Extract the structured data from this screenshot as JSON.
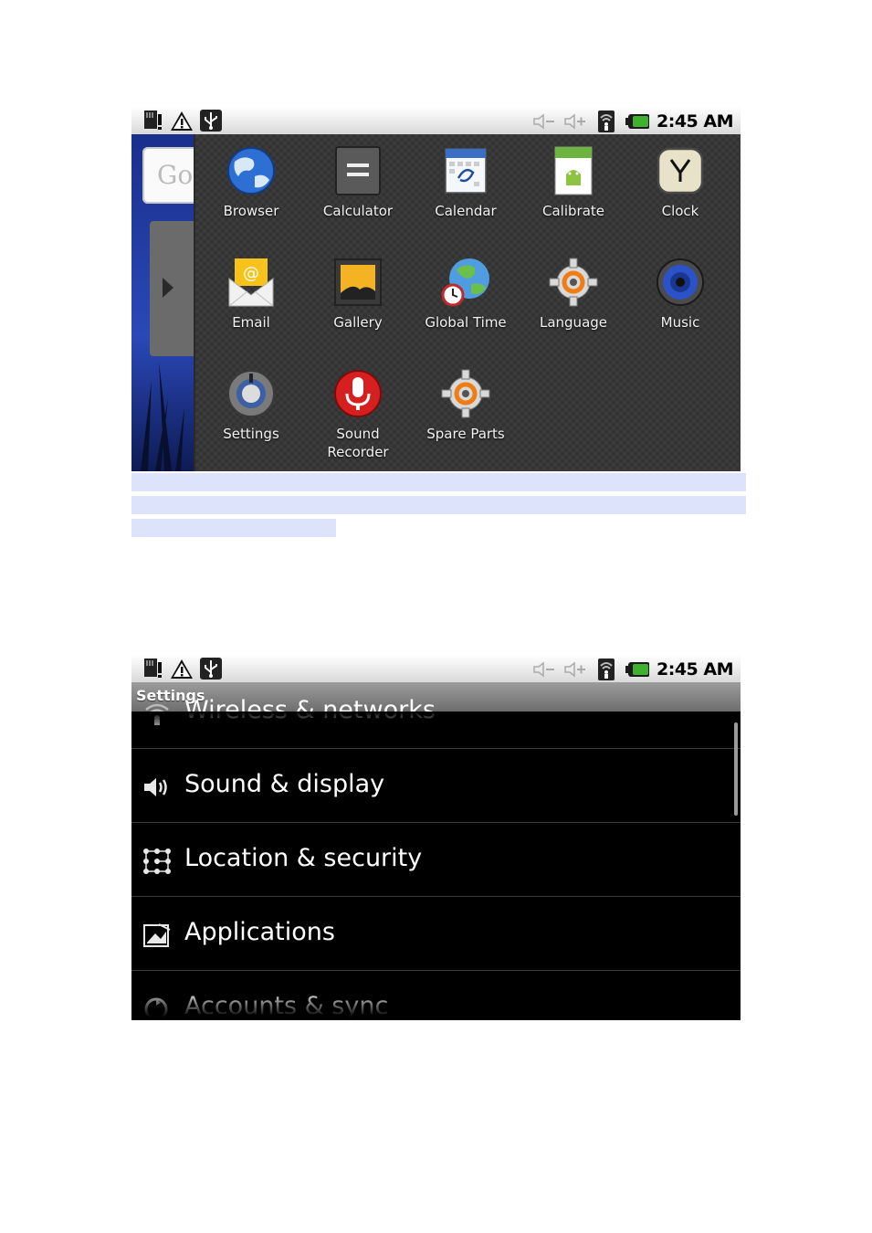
{
  "status_bar": {
    "time": "2:45 AM",
    "icons": [
      "sdcard-icon",
      "warning-icon",
      "usb-icon",
      "volume-muted-icon",
      "vibrate-icon",
      "signal-icon",
      "battery-icon"
    ]
  },
  "launcher": {
    "search_text": "Go",
    "apps": [
      {
        "label": "Browser",
        "icon": "browser-globe-icon"
      },
      {
        "label": "Calculator",
        "icon": "calculator-icon"
      },
      {
        "label": "Calendar",
        "icon": "calendar-icon"
      },
      {
        "label": "Calibrate",
        "icon": "android-calibrate-icon"
      },
      {
        "label": "Clock",
        "icon": "clock-icon"
      },
      {
        "label": "Email",
        "icon": "email-icon"
      },
      {
        "label": "Gallery",
        "icon": "gallery-icon"
      },
      {
        "label": "Global Time",
        "icon": "global-time-icon"
      },
      {
        "label": "Language",
        "icon": "language-gear-icon"
      },
      {
        "label": "Music",
        "icon": "music-speaker-icon"
      },
      {
        "label": "Settings",
        "icon": "settings-knob-icon"
      },
      {
        "label": "Sound",
        "label2": "Recorder",
        "icon": "microphone-icon"
      },
      {
        "label": "Spare Parts",
        "icon": "spare-parts-gear-icon"
      }
    ]
  },
  "settings": {
    "title": "Settings",
    "items": [
      {
        "label": "Wireless & networks",
        "icon": "wifi-icon"
      },
      {
        "label": "Sound & display",
        "icon": "speaker-icon"
      },
      {
        "label": "Location & security",
        "icon": "pattern-lock-icon"
      },
      {
        "label": "Applications",
        "icon": "applications-icon"
      },
      {
        "label": "Accounts & sync",
        "icon": "sync-icon"
      }
    ]
  },
  "colors": {
    "highlight": "#dde3fb",
    "launcher_bg": "#3b3b3b",
    "settings_bg": "#000000",
    "title_bar": "#8a8a8a"
  }
}
